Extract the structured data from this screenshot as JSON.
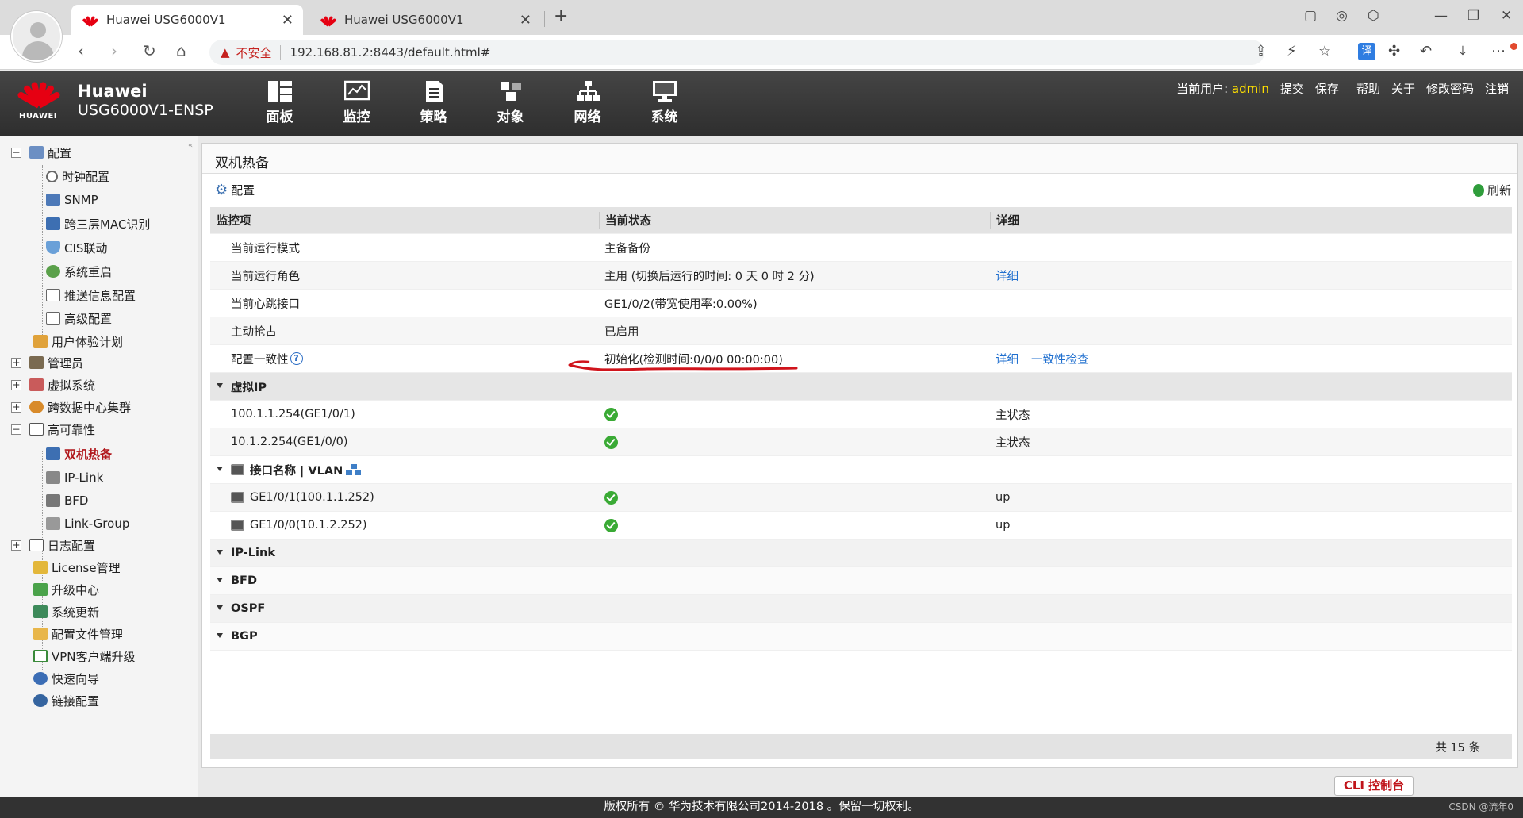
{
  "browser": {
    "tabs": [
      {
        "title": "Huawei USG6000V1",
        "active": true
      },
      {
        "title": "Huawei USG6000V1",
        "active": false
      }
    ],
    "new_tab": "+",
    "security_label": "不安全",
    "url": "192.168.81.2:8443/default.html#",
    "translate_label": "译"
  },
  "header": {
    "brand": "HUAWEI",
    "product_line1": "Huawei",
    "product_line2": "USG6000V1-ENSP",
    "nav": [
      {
        "label": "面板",
        "icon": "dashboard-icon"
      },
      {
        "label": "监控",
        "icon": "monitor-icon"
      },
      {
        "label": "策略",
        "icon": "policy-icon"
      },
      {
        "label": "对象",
        "icon": "object-icon"
      },
      {
        "label": "网络",
        "icon": "network-icon"
      },
      {
        "label": "系统",
        "icon": "system-icon"
      }
    ],
    "current_user_label": "当前用户:",
    "username": "admin",
    "links": [
      "提交",
      "保存",
      "帮助",
      "关于",
      "修改密码",
      "注销"
    ]
  },
  "sidebar": {
    "items": [
      {
        "label": "配置",
        "level": 0,
        "expander": "−"
      },
      {
        "label": "时钟配置",
        "level": 1
      },
      {
        "label": "SNMP",
        "level": 1
      },
      {
        "label": "跨三层MAC识别",
        "level": 1
      },
      {
        "label": "CIS联动",
        "level": 1
      },
      {
        "label": "系统重启",
        "level": 1
      },
      {
        "label": "推送信息配置",
        "level": 1
      },
      {
        "label": "高级配置",
        "level": 1
      },
      {
        "label": "用户体验计划",
        "level": 0
      },
      {
        "label": "管理员",
        "level": 0,
        "expander": "+"
      },
      {
        "label": "虚拟系统",
        "level": 0,
        "expander": "+"
      },
      {
        "label": "跨数据中心集群",
        "level": 0,
        "expander": "+"
      },
      {
        "label": "高可靠性",
        "level": 0,
        "expander": "−"
      },
      {
        "label": "双机热备",
        "level": 1,
        "selected": true
      },
      {
        "label": "IP-Link",
        "level": 1
      },
      {
        "label": "BFD",
        "level": 1
      },
      {
        "label": "Link-Group",
        "level": 1
      },
      {
        "label": "日志配置",
        "level": 0,
        "expander": "+"
      },
      {
        "label": "License管理",
        "level": 0
      },
      {
        "label": "升级中心",
        "level": 0
      },
      {
        "label": "系统更新",
        "level": 0
      },
      {
        "label": "配置文件管理",
        "level": 0
      },
      {
        "label": "VPN客户端升级",
        "level": 0
      },
      {
        "label": "快速向导",
        "level": 0
      },
      {
        "label": "链接配置",
        "level": 0
      }
    ]
  },
  "panel": {
    "title": "双机热备",
    "config_label": "配置",
    "refresh_label": "刷新",
    "columns": [
      "监控项",
      "当前状态",
      "详细"
    ],
    "rows": [
      {
        "item": "当前运行模式",
        "status": "主备备份"
      },
      {
        "item": "当前运行角色",
        "status": "主用 (切换后运行的时间: 0 天 0 时 2 分)",
        "links": [
          "详细"
        ]
      },
      {
        "item": "当前心跳接口",
        "status": "GE1/0/2(带宽使用率:0.00%)"
      },
      {
        "item": "主动抢占",
        "status": "已启用"
      },
      {
        "item": "配置一致性",
        "status": "初始化(检测时间:0/0/0 00:00:00)",
        "links": [
          "详细",
          "一致性检查"
        ],
        "help": "?"
      }
    ],
    "virtual_ip_group": "虚拟IP",
    "virtual_ips": [
      {
        "addr": "100.1.1.254(GE1/0/1)",
        "detail": "主状态"
      },
      {
        "addr": "10.1.2.254(GE1/0/0)",
        "detail": "主状态"
      }
    ],
    "interface_group": "接口名称 | VLAN",
    "interfaces": [
      {
        "name": "GE1/0/1(100.1.1.252)",
        "detail": "up"
      },
      {
        "name": "GE1/0/0(10.1.2.252)",
        "detail": "up"
      }
    ],
    "collapsed_groups": [
      "IP-Link",
      "BFD",
      "OSPF",
      "BGP"
    ],
    "total": "共 15 条"
  },
  "cli_button": "CLI 控制台",
  "footer": {
    "copyright": "版权所有 © 华为技术有限公司2014-2018 。保留一切权利。",
    "watermark": "CSDN @流年0"
  },
  "colors": {
    "huawei_red": "#e60012",
    "header_bg": "#3a3a3a",
    "link_blue": "#1f6fcf",
    "selected_red": "#b0161b",
    "ok_green": "#3aaa35",
    "username_yellow": "#ffe000"
  }
}
